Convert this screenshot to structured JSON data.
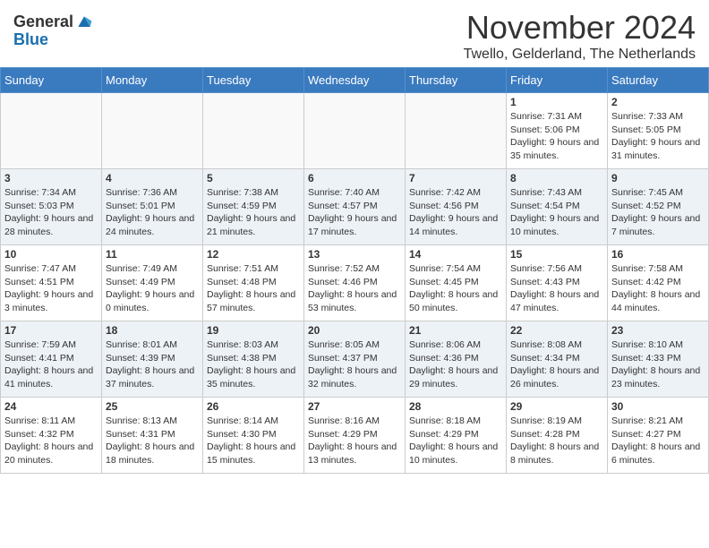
{
  "header": {
    "logo_line1": "General",
    "logo_line2": "Blue",
    "month_title": "November 2024",
    "subtitle": "Twello, Gelderland, The Netherlands"
  },
  "weekdays": [
    "Sunday",
    "Monday",
    "Tuesday",
    "Wednesday",
    "Thursday",
    "Friday",
    "Saturday"
  ],
  "weeks": [
    [
      {
        "day": "",
        "info": ""
      },
      {
        "day": "",
        "info": ""
      },
      {
        "day": "",
        "info": ""
      },
      {
        "day": "",
        "info": ""
      },
      {
        "day": "",
        "info": ""
      },
      {
        "day": "1",
        "info": "Sunrise: 7:31 AM\nSunset: 5:06 PM\nDaylight: 9 hours and 35 minutes."
      },
      {
        "day": "2",
        "info": "Sunrise: 7:33 AM\nSunset: 5:05 PM\nDaylight: 9 hours and 31 minutes."
      }
    ],
    [
      {
        "day": "3",
        "info": "Sunrise: 7:34 AM\nSunset: 5:03 PM\nDaylight: 9 hours and 28 minutes."
      },
      {
        "day": "4",
        "info": "Sunrise: 7:36 AM\nSunset: 5:01 PM\nDaylight: 9 hours and 24 minutes."
      },
      {
        "day": "5",
        "info": "Sunrise: 7:38 AM\nSunset: 4:59 PM\nDaylight: 9 hours and 21 minutes."
      },
      {
        "day": "6",
        "info": "Sunrise: 7:40 AM\nSunset: 4:57 PM\nDaylight: 9 hours and 17 minutes."
      },
      {
        "day": "7",
        "info": "Sunrise: 7:42 AM\nSunset: 4:56 PM\nDaylight: 9 hours and 14 minutes."
      },
      {
        "day": "8",
        "info": "Sunrise: 7:43 AM\nSunset: 4:54 PM\nDaylight: 9 hours and 10 minutes."
      },
      {
        "day": "9",
        "info": "Sunrise: 7:45 AM\nSunset: 4:52 PM\nDaylight: 9 hours and 7 minutes."
      }
    ],
    [
      {
        "day": "10",
        "info": "Sunrise: 7:47 AM\nSunset: 4:51 PM\nDaylight: 9 hours and 3 minutes."
      },
      {
        "day": "11",
        "info": "Sunrise: 7:49 AM\nSunset: 4:49 PM\nDaylight: 9 hours and 0 minutes."
      },
      {
        "day": "12",
        "info": "Sunrise: 7:51 AM\nSunset: 4:48 PM\nDaylight: 8 hours and 57 minutes."
      },
      {
        "day": "13",
        "info": "Sunrise: 7:52 AM\nSunset: 4:46 PM\nDaylight: 8 hours and 53 minutes."
      },
      {
        "day": "14",
        "info": "Sunrise: 7:54 AM\nSunset: 4:45 PM\nDaylight: 8 hours and 50 minutes."
      },
      {
        "day": "15",
        "info": "Sunrise: 7:56 AM\nSunset: 4:43 PM\nDaylight: 8 hours and 47 minutes."
      },
      {
        "day": "16",
        "info": "Sunrise: 7:58 AM\nSunset: 4:42 PM\nDaylight: 8 hours and 44 minutes."
      }
    ],
    [
      {
        "day": "17",
        "info": "Sunrise: 7:59 AM\nSunset: 4:41 PM\nDaylight: 8 hours and 41 minutes."
      },
      {
        "day": "18",
        "info": "Sunrise: 8:01 AM\nSunset: 4:39 PM\nDaylight: 8 hours and 37 minutes."
      },
      {
        "day": "19",
        "info": "Sunrise: 8:03 AM\nSunset: 4:38 PM\nDaylight: 8 hours and 35 minutes."
      },
      {
        "day": "20",
        "info": "Sunrise: 8:05 AM\nSunset: 4:37 PM\nDaylight: 8 hours and 32 minutes."
      },
      {
        "day": "21",
        "info": "Sunrise: 8:06 AM\nSunset: 4:36 PM\nDaylight: 8 hours and 29 minutes."
      },
      {
        "day": "22",
        "info": "Sunrise: 8:08 AM\nSunset: 4:34 PM\nDaylight: 8 hours and 26 minutes."
      },
      {
        "day": "23",
        "info": "Sunrise: 8:10 AM\nSunset: 4:33 PM\nDaylight: 8 hours and 23 minutes."
      }
    ],
    [
      {
        "day": "24",
        "info": "Sunrise: 8:11 AM\nSunset: 4:32 PM\nDaylight: 8 hours and 20 minutes."
      },
      {
        "day": "25",
        "info": "Sunrise: 8:13 AM\nSunset: 4:31 PM\nDaylight: 8 hours and 18 minutes."
      },
      {
        "day": "26",
        "info": "Sunrise: 8:14 AM\nSunset: 4:30 PM\nDaylight: 8 hours and 15 minutes."
      },
      {
        "day": "27",
        "info": "Sunrise: 8:16 AM\nSunset: 4:29 PM\nDaylight: 8 hours and 13 minutes."
      },
      {
        "day": "28",
        "info": "Sunrise: 8:18 AM\nSunset: 4:29 PM\nDaylight: 8 hours and 10 minutes."
      },
      {
        "day": "29",
        "info": "Sunrise: 8:19 AM\nSunset: 4:28 PM\nDaylight: 8 hours and 8 minutes."
      },
      {
        "day": "30",
        "info": "Sunrise: 8:21 AM\nSunset: 4:27 PM\nDaylight: 8 hours and 6 minutes."
      }
    ]
  ]
}
